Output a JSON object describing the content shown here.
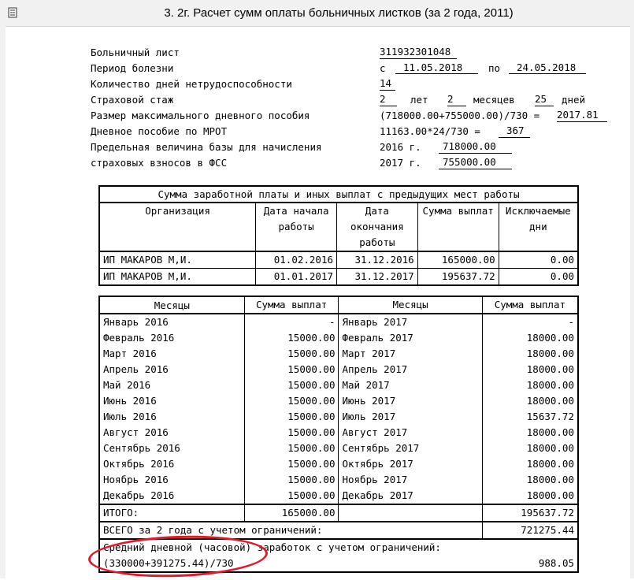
{
  "window": {
    "title": "3. 2г. Расчет сумм оплаты больничных листков (за 2 года, 2011)"
  },
  "header": {
    "sick_leave_label": "Больничный лист",
    "sick_leave_number": "311932301048",
    "period_label": "Период болезни",
    "period_from_prefix": "с",
    "period_from": "11.05.2018",
    "period_to_prefix": "по",
    "period_to": "24.05.2018",
    "days_label": "Количество дней нетрудоспособности",
    "days": "14",
    "experience_label": "Страховой стаж",
    "exp_years": "2",
    "exp_years_unit": "лет",
    "exp_months": "2",
    "exp_months_unit": "месяцев",
    "exp_days": "25",
    "exp_days_unit": "дней",
    "max_daily_label": "Размер максимального дневного пособия",
    "max_daily_formula": "(718000.00+755000.00)/730 =",
    "max_daily_value": "2017.81",
    "mrot_label": "Дневное пособие по МРОТ",
    "mrot_formula": "11163.00*24/730 =",
    "mrot_value": "367",
    "base_limit_label_1": "Предельная величина базы для начисления",
    "base_limit_label_2": "страховых взносов в ФСС",
    "year1_label": "2016 г.",
    "year1_value": "718000.00",
    "year2_label": "2017 г.",
    "year2_value": "755000.00"
  },
  "prev_jobs": {
    "title": "Сумма заработной платы и иных выплат с предыдущих мест работы",
    "columns": [
      "Организация",
      "Дата начала\nработы",
      "Дата\nокончания\nработы",
      "Сумма выплат",
      "Исключаемые\nдни"
    ],
    "rows": [
      [
        "ИП МАКАРОВ М,И.",
        "01.02.2016",
        "31.12.2016",
        "165000.00",
        "0.00"
      ],
      [
        "ИП МАКАРОВ М,И.",
        "01.01.2017",
        "31.12.2017",
        "195637.72",
        "0.00"
      ]
    ]
  },
  "months": {
    "columns": [
      "Месяцы",
      "Сумма выплат",
      "Месяцы",
      "Сумма выплат"
    ],
    "rows": [
      [
        "Январь 2016",
        "-",
        "Январь 2017",
        "-"
      ],
      [
        "Февраль 2016",
        "15000.00",
        "Февраль 2017",
        "18000.00"
      ],
      [
        "Март 2016",
        "15000.00",
        "Март 2017",
        "18000.00"
      ],
      [
        "Апрель 2016",
        "15000.00",
        "Апрель 2017",
        "18000.00"
      ],
      [
        "Май 2016",
        "15000.00",
        "Май 2017",
        "18000.00"
      ],
      [
        "Июнь 2016",
        "15000.00",
        "Июнь 2017",
        "18000.00"
      ],
      [
        "Июль 2016",
        "15000.00",
        "Июль 2017",
        "15637.72"
      ],
      [
        "Август 2016",
        "15000.00",
        "Август 2017",
        "18000.00"
      ],
      [
        "Сентябрь 2016",
        "15000.00",
        "Сентябрь 2017",
        "18000.00"
      ],
      [
        "Октябрь 2016",
        "15000.00",
        "Октябрь 2017",
        "18000.00"
      ],
      [
        "Ноябрь 2016",
        "15000.00",
        "Ноябрь 2017",
        "18000.00"
      ],
      [
        "Декабрь 2016",
        "15000.00",
        "Декабрь 2017",
        "18000.00"
      ]
    ],
    "total_label": "ИТОГО:",
    "total_2016": "165000.00",
    "total_2017": "195637.72",
    "grand_total_label": "ВСЕГО за 2 года с учетом ограничений:",
    "grand_total": "721275.44",
    "avg_label": "Средний дневной (часовой) заработок с учетом ограничений:",
    "avg_formula": "(330000+391275.44)/730",
    "avg_value": "988.05"
  },
  "annotation_color": "#e3172a"
}
